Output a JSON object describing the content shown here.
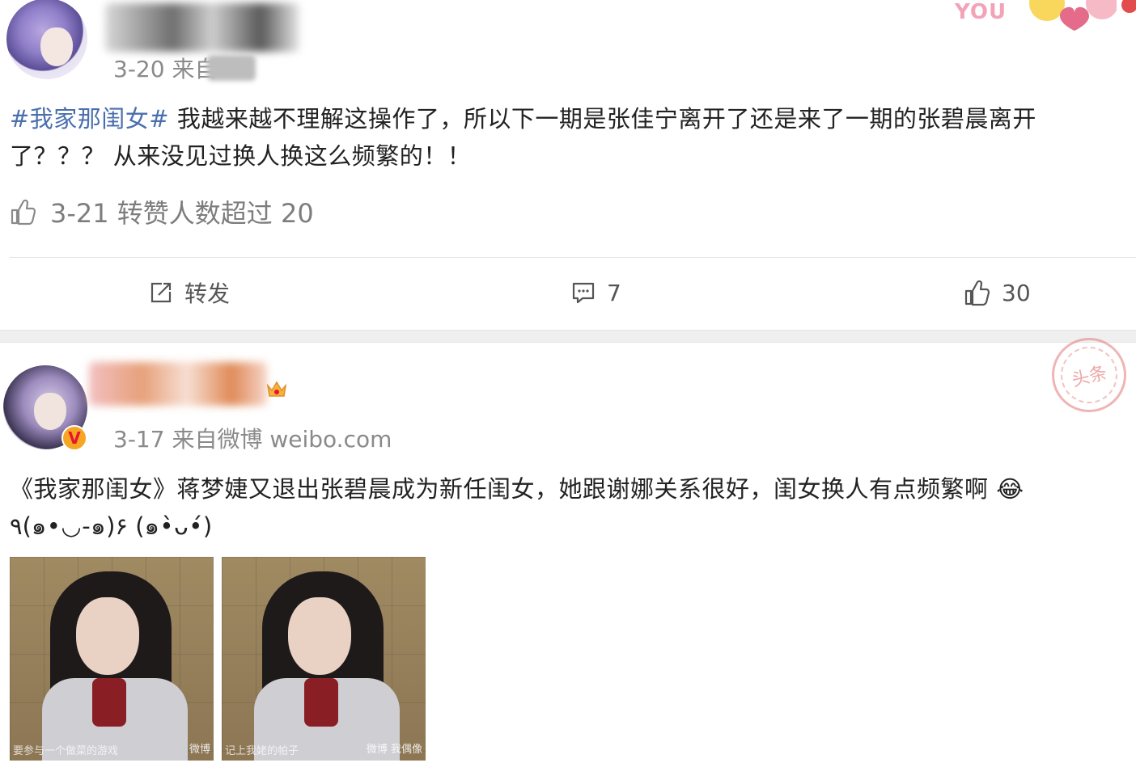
{
  "posts": [
    {
      "meta": "3-20  来自",
      "hashtag": "#我家那闺女#",
      "body_first": " 我越来越不理解这操作了，所以下一期是张佳宁离开了还是来了一期的张碧晨离开",
      "body_second": "了？？？ 从来没见过换人换这么频繁的！！",
      "liked_info": "3-21 转赞人数超过 20",
      "actions": {
        "repost_label": "转发",
        "comment_count": "7",
        "like_count": "30"
      }
    },
    {
      "meta": "3-17  来自微博 weibo.com",
      "vip_badge": "V",
      "body_first": "《我家那闺女》蒋梦婕又退出张碧晨成为新任闺女，她跟谢娜关系很好，闺女换人有点频繁啊 😂",
      "body_second": "٩(๑•◡-๑)۶ (๑•̀ᴗ•́)",
      "images": [
        {
          "caption": "要参与一个做菜的游戏",
          "watermark": "微博"
        },
        {
          "caption": "记上我姥的帕子",
          "watermark": "微博 我偶像"
        }
      ]
    }
  ],
  "decorations": {
    "you_text": "YOU",
    "stamp_text": "头条"
  },
  "colors": {
    "topic_link": "#4a6fae",
    "meta_gray": "#8a8a8a",
    "separator": "#efefef",
    "vip": "#f6a623"
  }
}
